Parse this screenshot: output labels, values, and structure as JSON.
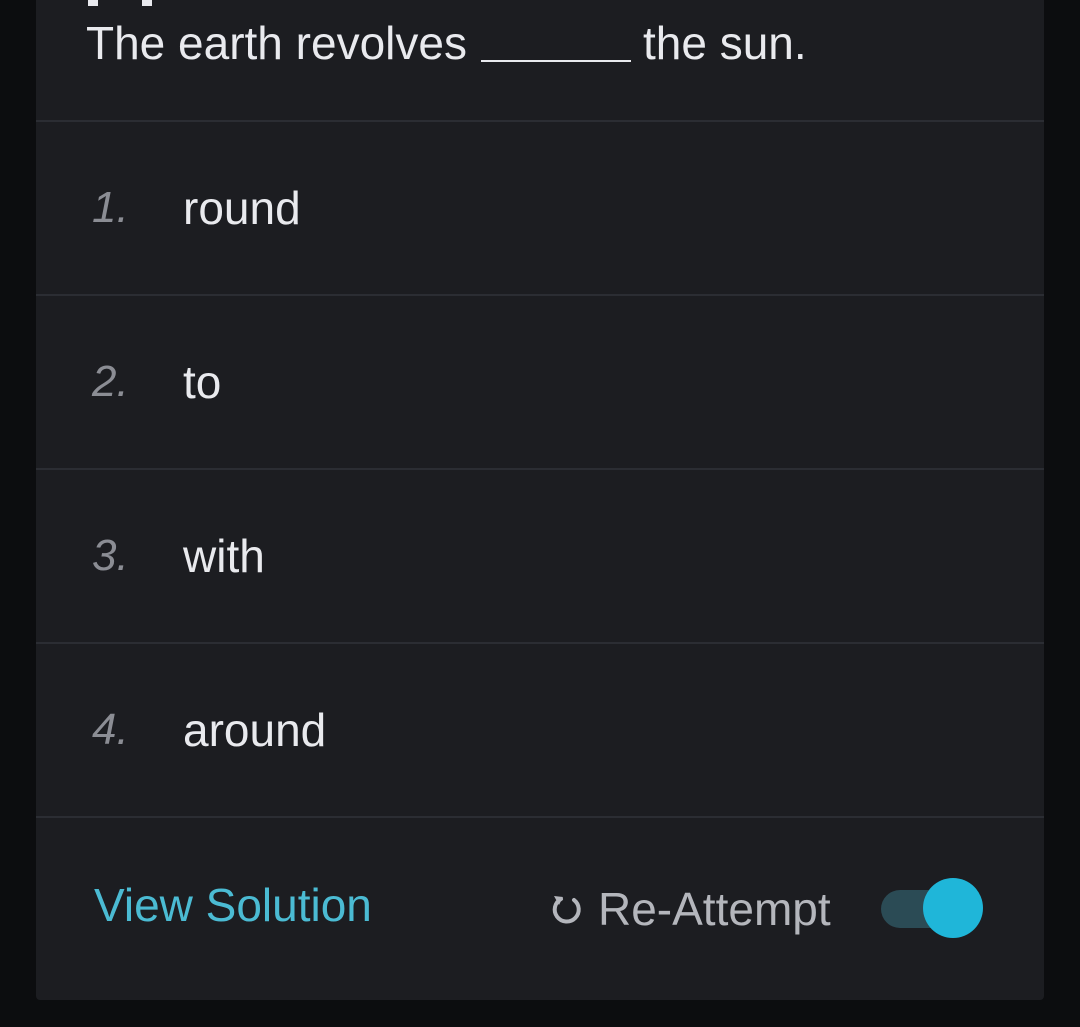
{
  "question": {
    "text_before": "The earth revolves",
    "text_after": "the sun."
  },
  "options": [
    {
      "number": "1.",
      "label": "round"
    },
    {
      "number": "2.",
      "label": "to"
    },
    {
      "number": "3.",
      "label": "with"
    },
    {
      "number": "4.",
      "label": "around"
    }
  ],
  "footer": {
    "view_solution_label": "View Solution",
    "reattempt_label": "Re-Attempt",
    "reattempt_icon": "refresh-icon",
    "toggle_on": true
  },
  "colors": {
    "accent": "#1fb6d9",
    "link": "#4bbbd3",
    "card_bg": "#1c1d21",
    "page_bg": "#0c0d0f"
  }
}
